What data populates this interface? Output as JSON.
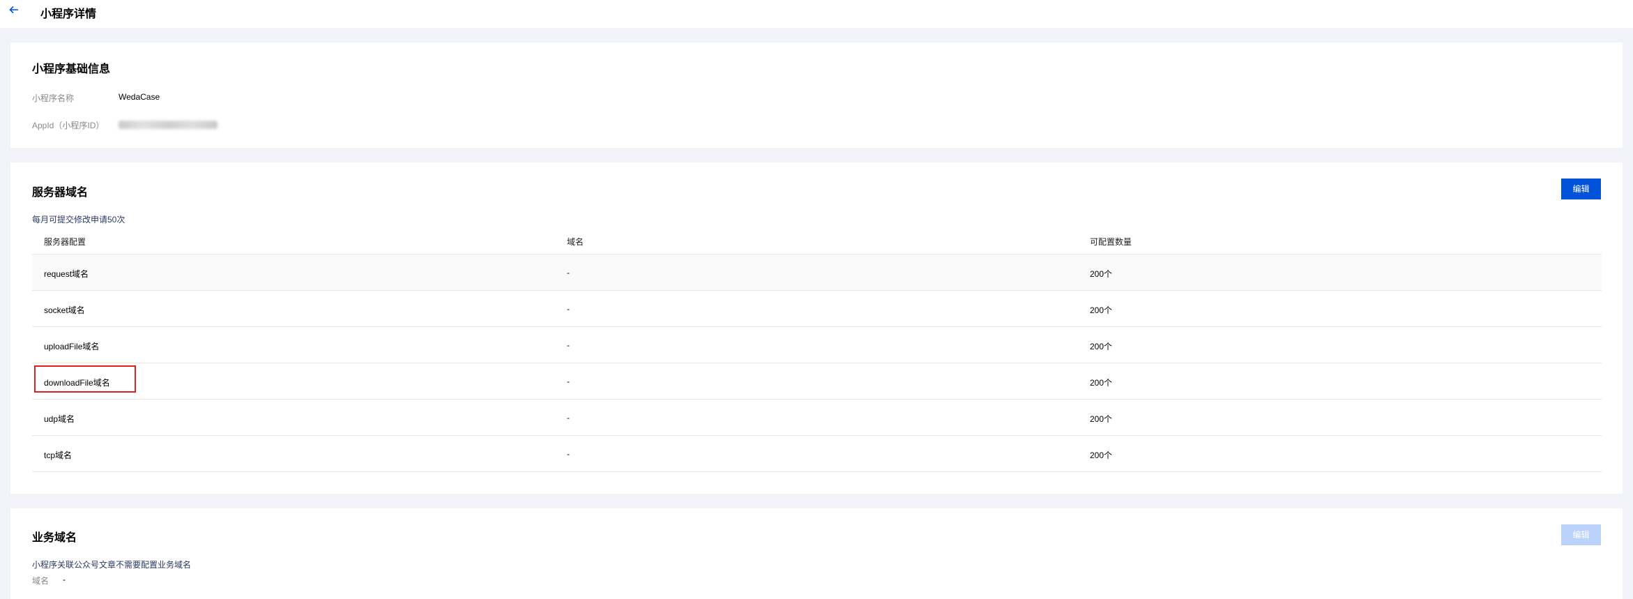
{
  "header": {
    "back_icon": "arrow-left-icon",
    "title": "小程序详情"
  },
  "basic_info": {
    "title": "小程序基础信息",
    "name_label": "小程序名称",
    "name_value": "WedaCase",
    "appid_label": "AppId（小程序ID）"
  },
  "server_domain": {
    "title": "服务器域名",
    "edit_label": "编辑",
    "hint": "每月可提交修改申请50次",
    "columns": [
      "服务器配置",
      "域名",
      "可配置数量"
    ],
    "rows": [
      {
        "config": "request域名",
        "domain": "-",
        "count": "200个"
      },
      {
        "config": "socket域名",
        "domain": "-",
        "count": "200个"
      },
      {
        "config": "uploadFile域名",
        "domain": "-",
        "count": "200个"
      },
      {
        "config": "downloadFile域名",
        "domain": "-",
        "count": "200个"
      },
      {
        "config": "udp域名",
        "domain": "-",
        "count": "200个"
      },
      {
        "config": "tcp域名",
        "domain": "-",
        "count": "200个"
      }
    ],
    "highlighted_row": 3,
    "highlight_color": "#e02020"
  },
  "business_domain": {
    "title": "业务域名",
    "edit_label": "编辑",
    "hint": "小程序关联公众号文章不需要配置业务域名",
    "domain_label": "域名",
    "domain_value": "-"
  },
  "colors": {
    "accent": "#0052d9",
    "accent_disabled": "#bbd3fb",
    "background": "#f2f3f8"
  }
}
